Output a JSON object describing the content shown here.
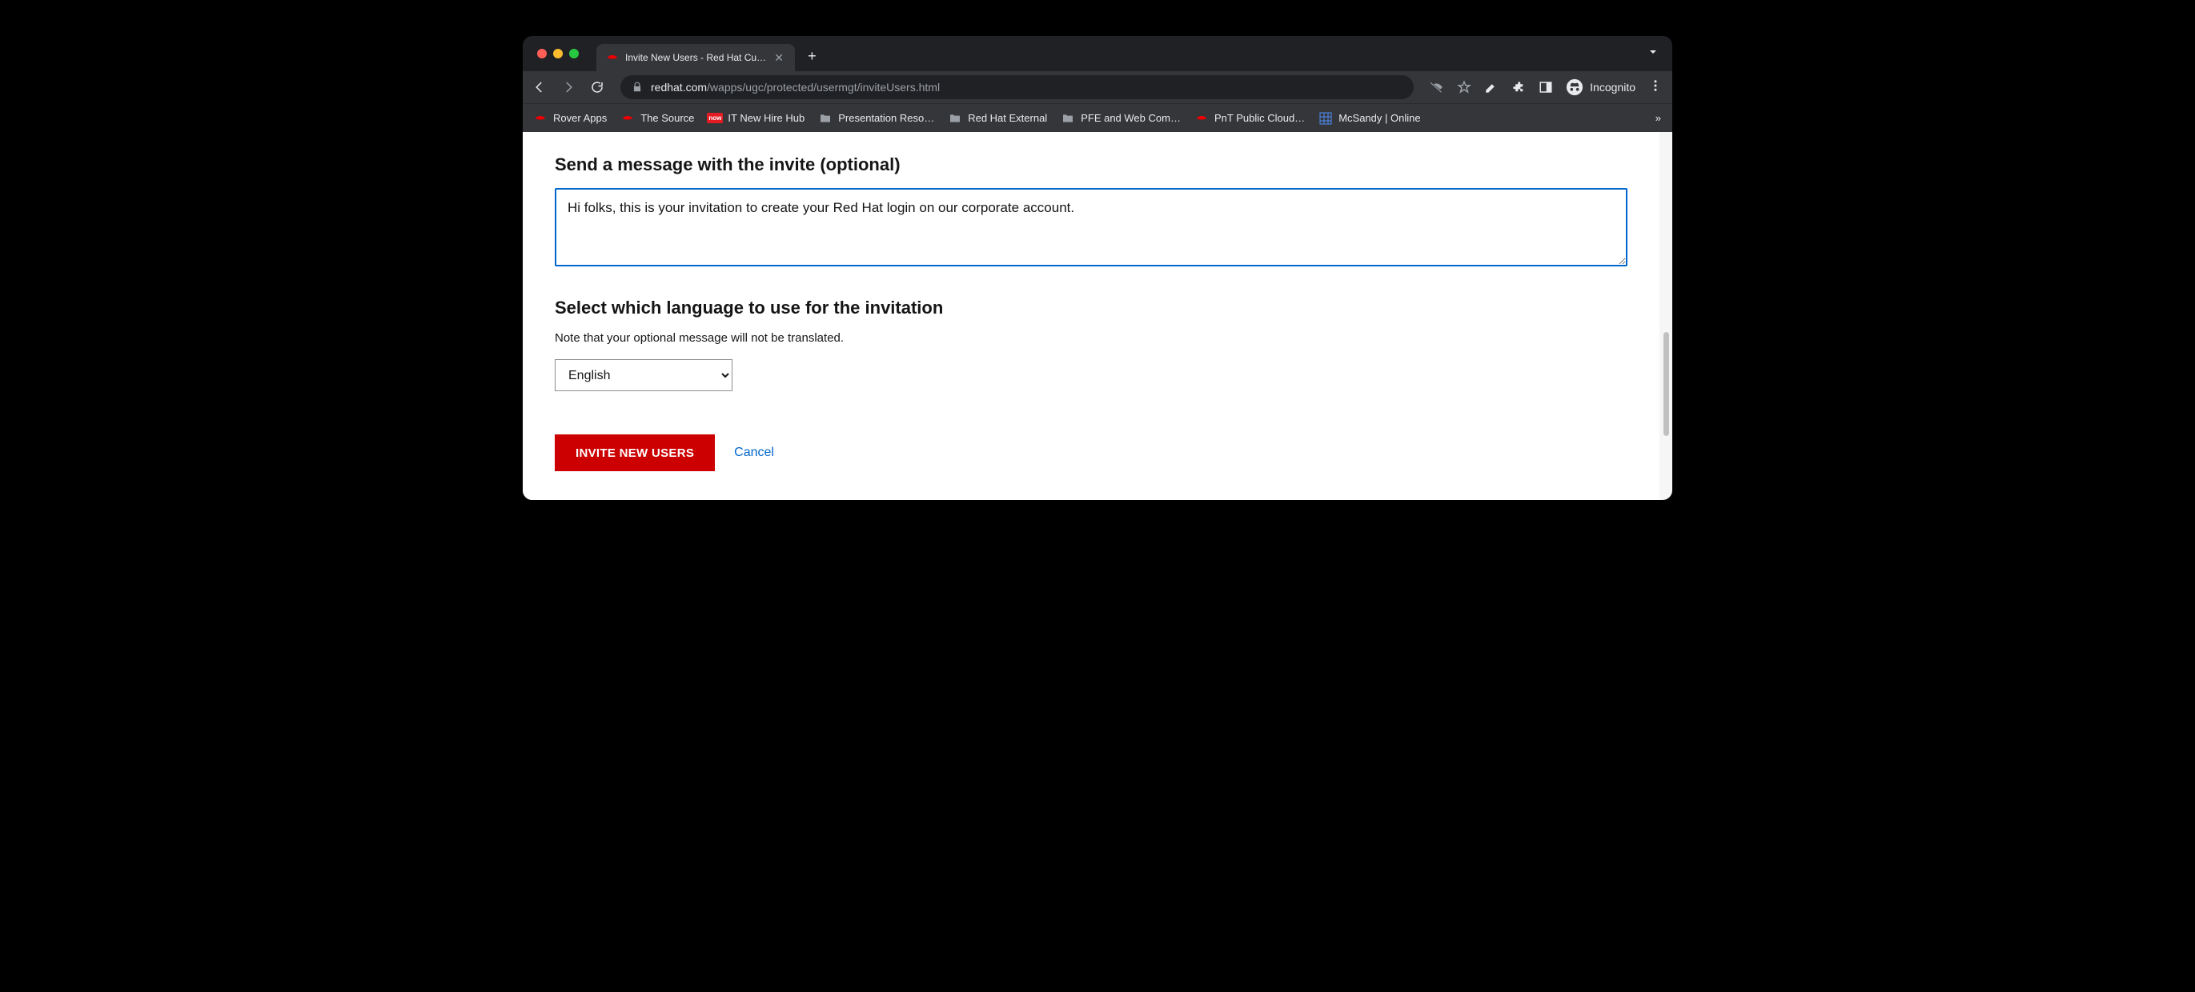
{
  "browser": {
    "tab_title": "Invite New Users - Red Hat Cu…",
    "url_domain": "redhat.com",
    "url_path": "/wapps/ugc/protected/usermgt/inviteUsers.html",
    "incognito_label": "Incognito"
  },
  "bookmarks": [
    {
      "label": "Rover Apps",
      "icon": "redhat"
    },
    {
      "label": "The Source",
      "icon": "redhat"
    },
    {
      "label": "IT New Hire Hub",
      "icon": "now"
    },
    {
      "label": "Presentation Reso…",
      "icon": "folder"
    },
    {
      "label": "Red Hat External",
      "icon": "folder"
    },
    {
      "label": "PFE and Web Com…",
      "icon": "folder"
    },
    {
      "label": "PnT Public Cloud…",
      "icon": "redhat"
    },
    {
      "label": "McSandy | Online",
      "icon": "grid"
    }
  ],
  "page": {
    "message_heading": "Send a message with the invite (optional)",
    "message_value": "Hi folks, this is your invitation to create your Red Hat login on our corporate account. ",
    "language_heading": "Select which language to use for the invitation",
    "language_note": "Note that your optional message will not be translated.",
    "language_selected": "English",
    "submit_label": "INVITE NEW USERS",
    "cancel_label": "Cancel"
  }
}
